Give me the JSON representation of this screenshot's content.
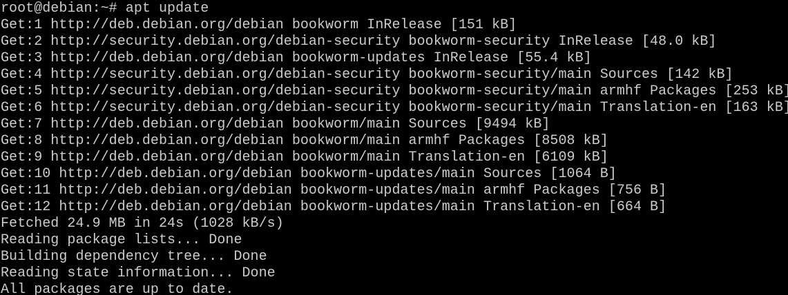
{
  "terminal": {
    "background": "#000000",
    "foreground": "#cccccc",
    "lines": [
      "root@debian:~# apt update",
      "Get:1 http://deb.debian.org/debian bookworm InRelease [151 kB]",
      "Get:2 http://security.debian.org/debian-security bookworm-security InRelease [48.0 kB]",
      "Get:3 http://deb.debian.org/debian bookworm-updates InRelease [55.4 kB]",
      "Get:4 http://security.debian.org/debian-security bookworm-security/main Sources [142 kB]",
      "Get:5 http://security.debian.org/debian-security bookworm-security/main armhf Packages [253 kB]",
      "Get:6 http://security.debian.org/debian-security bookworm-security/main Translation-en [163 kB]",
      "Get:7 http://deb.debian.org/debian bookworm/main Sources [9494 kB]",
      "Get:8 http://deb.debian.org/debian bookworm/main armhf Packages [8508 kB]",
      "Get:9 http://deb.debian.org/debian bookworm/main Translation-en [6109 kB]",
      "Get:10 http://deb.debian.org/debian bookworm-updates/main Sources [1064 B]",
      "Get:11 http://deb.debian.org/debian bookworm-updates/main armhf Packages [756 B]",
      "Get:12 http://deb.debian.org/debian bookworm-updates/main Translation-en [664 B]",
      "Fetched 24.9 MB in 24s (1028 kB/s)",
      "Reading package lists... Done",
      "Building dependency tree... Done",
      "Reading state information... Done",
      "All packages are up to date."
    ]
  }
}
